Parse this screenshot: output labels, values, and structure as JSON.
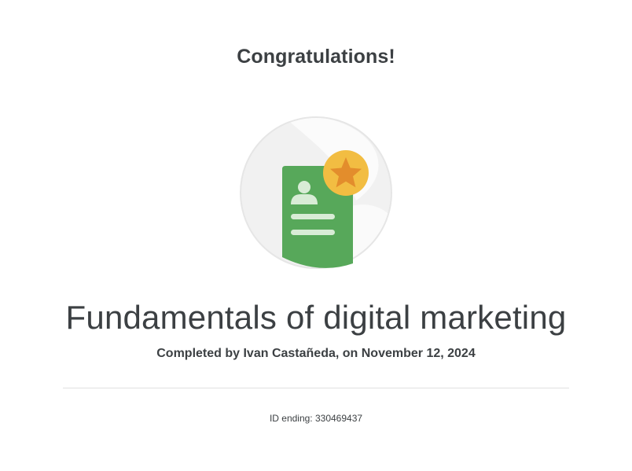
{
  "headline": "Congratulations!",
  "badge": {
    "icon": "certificate-badge-icon",
    "colors": {
      "document_green": "#57a85a",
      "star_circle": "#f2bd42",
      "star": "#e38d2c",
      "lines": "#d8ecd6"
    }
  },
  "course_title": "Fundamentals of digital marketing",
  "completion_text": "Completed by Ivan Castañeda, on November 12, 2024",
  "id_text": "ID ending: 330469437"
}
